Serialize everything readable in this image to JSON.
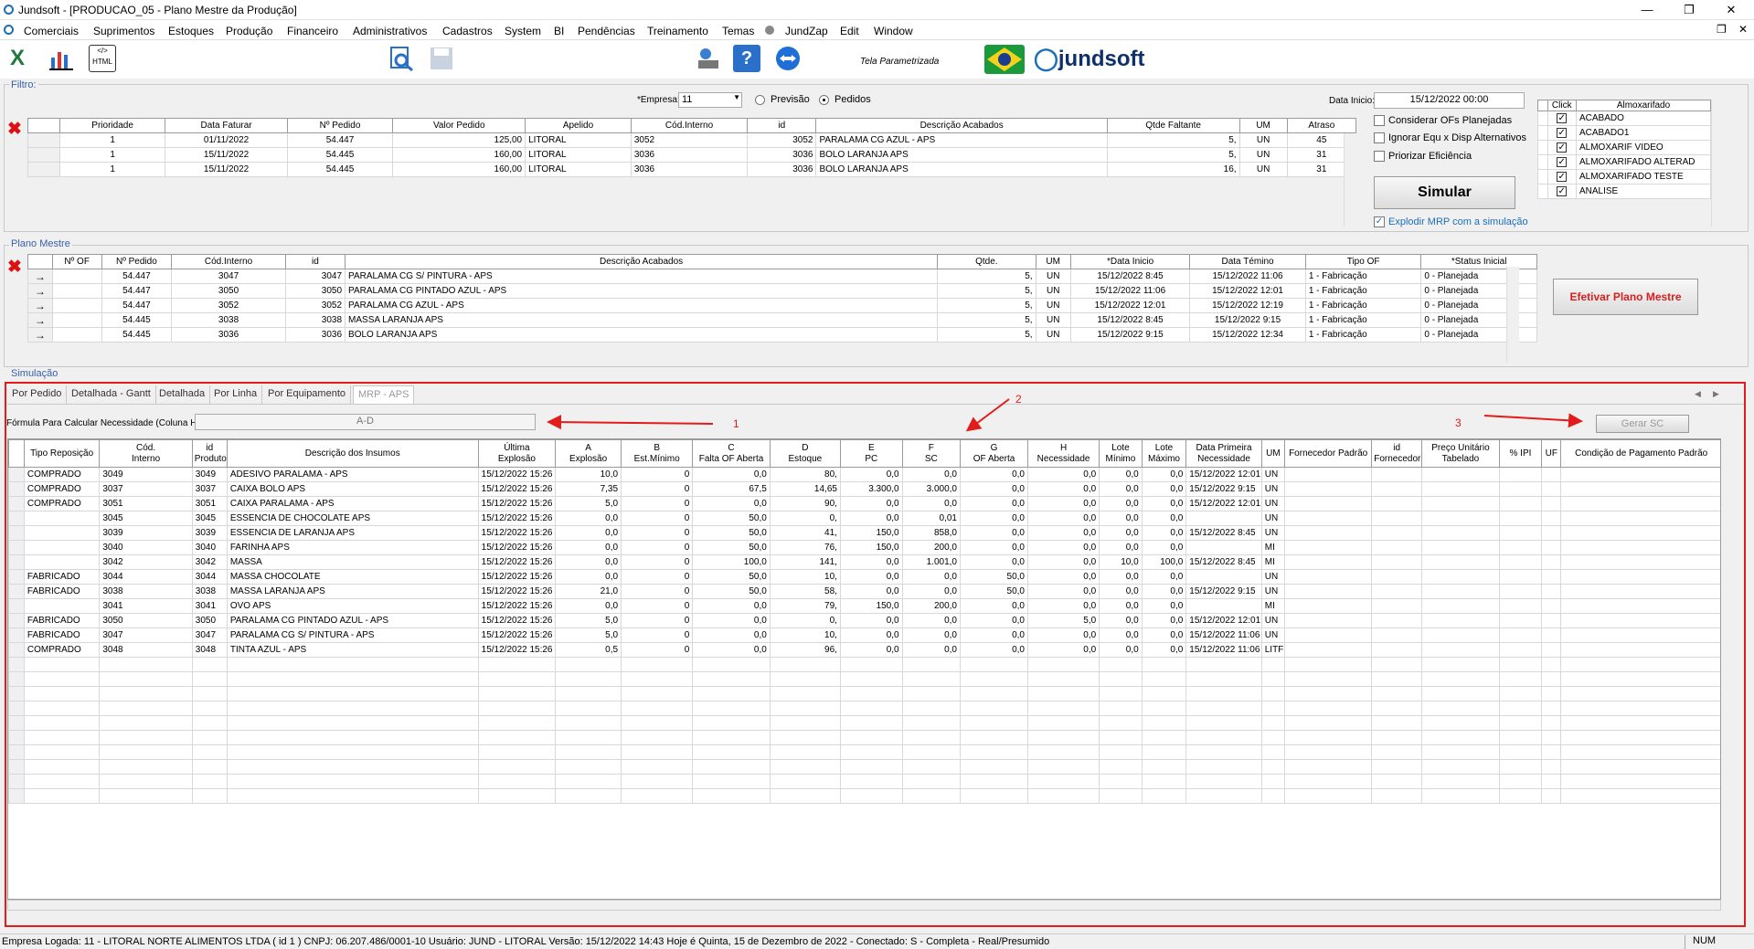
{
  "window": {
    "title": "Jundsoft - [PRODUCAO_05 - Plano Mestre da Produção]"
  },
  "menu": [
    "Comerciais",
    "Suprimentos",
    "Estoques",
    "Produção",
    "Financeiro",
    "Administrativos",
    "Cadastros",
    "System",
    "BI",
    "Pendências",
    "Treinamento",
    "Temas",
    "JundZap",
    "Edit",
    "Window"
  ],
  "toolbar": {
    "tela": "Tela Parametrizada",
    "brand": "jundsoft"
  },
  "filtro": {
    "label": "Filtro:",
    "empresa_label": "*Empresa:",
    "empresa_value": "11",
    "previsao": "Previsão",
    "pedidos": "Pedidos",
    "data_inicio_label": "Data Inicio:",
    "data_inicio": "15/12/2022 00:00",
    "opt1": "Considerar OFs Planejadas",
    "opt2": "Ignorar Equ x Disp Alternativos",
    "opt3": "Priorizar Eficiência",
    "simular": "Simular",
    "explodir": "Explodir MRP com a simulação",
    "columns": [
      "Prioridade",
      "Data Faturar",
      "Nº Pedido",
      "Valor Pedido",
      "Apelido",
      "Cód.Interno",
      "id",
      "Descrição Acabados",
      "Qtde Faltante",
      "UM",
      "Atraso"
    ],
    "rows": [
      [
        "1",
        "01/11/2022",
        "54.447",
        "125,00",
        "LITORAL",
        "3052",
        "3052",
        "PARALAMA CG AZUL - APS",
        "5,",
        "UN",
        "45"
      ],
      [
        "1",
        "15/11/2022",
        "54.445",
        "160,00",
        "LITORAL",
        "3036",
        "3036",
        "BOLO LARANJA APS",
        "5,",
        "UN",
        "31"
      ],
      [
        "1",
        "15/11/2022",
        "54.445",
        "160,00",
        "LITORAL",
        "3036",
        "3036",
        "BOLO LARANJA APS",
        "16,",
        "UN",
        "31"
      ]
    ],
    "almox_columns": [
      "Click",
      "Almoxarifado"
    ],
    "almox": [
      "ACABADO",
      "ACABADO1",
      "ALMOXARIF VIDEO",
      "ALMOXARIFADO ALTERAD",
      "ALMOXARIFADO TESTE",
      "ANALISE"
    ]
  },
  "plano": {
    "label": "Plano Mestre",
    "efetivar": "Efetivar Plano Mestre",
    "columns": [
      "Nº OF",
      "Nº Pedido",
      "Cód.Interno",
      "id",
      "Descrição Acabados",
      "Qtde.",
      "UM",
      "*Data Inicio",
      "Data Témino",
      "Tipo OF",
      "*Status Inicial"
    ],
    "rows": [
      [
        "",
        "54.447",
        "3047",
        "3047",
        "PARALAMA CG S/ PINTURA - APS",
        "5,",
        "UN",
        "15/12/2022 8:45",
        "15/12/2022 11:06",
        "1 - Fabricação",
        "0 - Planejada"
      ],
      [
        "",
        "54.447",
        "3050",
        "3050",
        "PARALAMA CG PINTADO AZUL - APS",
        "5,",
        "UN",
        "15/12/2022 11:06",
        "15/12/2022 12:01",
        "1 - Fabricação",
        "0 - Planejada"
      ],
      [
        "",
        "54.447",
        "3052",
        "3052",
        "PARALAMA CG AZUL - APS",
        "5,",
        "UN",
        "15/12/2022 12:01",
        "15/12/2022 12:19",
        "1 - Fabricação",
        "0 - Planejada"
      ],
      [
        "",
        "54.445",
        "3038",
        "3038",
        "MASSA LARANJA APS",
        "5,",
        "UN",
        "15/12/2022 8:45",
        "15/12/2022 9:15",
        "1 - Fabricação",
        "0 - Planejada"
      ],
      [
        "",
        "54.445",
        "3036",
        "3036",
        "BOLO LARANJA APS",
        "5,",
        "UN",
        "15/12/2022 9:15",
        "15/12/2022 12:34",
        "1 - Fabricação",
        "0 - Planejada"
      ]
    ]
  },
  "simulacao": {
    "label": "Simulação",
    "tabs": [
      "Por Pedido",
      "Detalhada - Gantt",
      "Detalhada",
      "Por Linha",
      "Por Equipamento",
      "MRP - APS"
    ],
    "formula_label": "Fórmula Para Calcular Necessidade (Coluna H):",
    "formula": "A-D",
    "gerar": "Gerar SC",
    "annot": [
      "1",
      "2",
      "3"
    ],
    "columns": [
      {
        "l1": "",
        "l2": "Tipo Reposição"
      },
      {
        "l1": "Cód.",
        "l2": "Interno"
      },
      {
        "l1": "id",
        "l2": "Produto"
      },
      {
        "l1": "",
        "l2": "Descrição dos Insumos"
      },
      {
        "l1": "Última",
        "l2": "Explosão"
      },
      {
        "l1": "A",
        "l2": "Explosão"
      },
      {
        "l1": "B",
        "l2": "Est.Mínimo"
      },
      {
        "l1": "C",
        "l2": "Falta OF Aberta"
      },
      {
        "l1": "D",
        "l2": "Estoque"
      },
      {
        "l1": "E",
        "l2": "PC"
      },
      {
        "l1": "F",
        "l2": "SC"
      },
      {
        "l1": "G",
        "l2": "OF Aberta"
      },
      {
        "l1": "H",
        "l2": "Necessidade"
      },
      {
        "l1": "Lote",
        "l2": "Mínimo"
      },
      {
        "l1": "Lote",
        "l2": "Máximo"
      },
      {
        "l1": "Data Primeira",
        "l2": "Necessidade"
      },
      {
        "l1": "",
        "l2": "UM"
      },
      {
        "l1": "",
        "l2": "Fornecedor Padrão"
      },
      {
        "l1": "id",
        "l2": "Fornecedor"
      },
      {
        "l1": "Preço Unitário",
        "l2": "Tabelado"
      },
      {
        "l1": "",
        "l2": "% IPI"
      },
      {
        "l1": "",
        "l2": "UF"
      },
      {
        "l1": "",
        "l2": "Condição de Pagamento Padrão"
      }
    ],
    "rows": [
      [
        "COMPRADO",
        "3049",
        "3049",
        "ADESIVO PARALAMA - APS",
        "15/12/2022 15:26",
        "10,0",
        "0",
        "0,0",
        "80,",
        "0,0",
        "0,0",
        "0,0",
        "0,0",
        "0,0",
        "0,0",
        "15/12/2022 12:01",
        "UN",
        "",
        "",
        "",
        "",
        "",
        ""
      ],
      [
        "COMPRADO",
        "3037",
        "3037",
        "CAIXA BOLO APS",
        "15/12/2022 15:26",
        "7,35",
        "0",
        "67,5",
        "14,65",
        "3.300,0",
        "3.000,0",
        "0,0",
        "0,0",
        "0,0",
        "0,0",
        "15/12/2022 9:15",
        "UN",
        "",
        "",
        "",
        "",
        "",
        ""
      ],
      [
        "COMPRADO",
        "3051",
        "3051",
        "CAIXA PARALAMA - APS",
        "15/12/2022 15:26",
        "5,0",
        "0",
        "0,0",
        "90,",
        "0,0",
        "0,0",
        "0,0",
        "0,0",
        "0,0",
        "0,0",
        "15/12/2022 12:01",
        "UN",
        "",
        "",
        "",
        "",
        "",
        ""
      ],
      [
        "",
        "3045",
        "3045",
        "ESSENCIA DE CHOCOLATE APS",
        "15/12/2022 15:26",
        "0,0",
        "0",
        "50,0",
        "0,",
        "0,0",
        "0,01",
        "0,0",
        "0,0",
        "0,0",
        "0,0",
        "",
        "UN",
        "",
        "",
        "",
        "",
        "",
        ""
      ],
      [
        "",
        "3039",
        "3039",
        "ESSENCIA DE LARANJA APS",
        "15/12/2022 15:26",
        "0,0",
        "0",
        "50,0",
        "41,",
        "150,0",
        "858,0",
        "0,0",
        "0,0",
        "0,0",
        "0,0",
        "15/12/2022 8:45",
        "UN",
        "",
        "",
        "",
        "",
        "",
        ""
      ],
      [
        "",
        "3040",
        "3040",
        "FARINHA APS",
        "15/12/2022 15:26",
        "0,0",
        "0",
        "50,0",
        "76,",
        "150,0",
        "200,0",
        "0,0",
        "0,0",
        "0,0",
        "0,0",
        "",
        "MI",
        "",
        "",
        "",
        "",
        "",
        ""
      ],
      [
        "",
        "3042",
        "3042",
        "MASSA",
        "15/12/2022 15:26",
        "0,0",
        "0",
        "100,0",
        "141,",
        "0,0",
        "1.001,0",
        "0,0",
        "0,0",
        "10,0",
        "100,0",
        "15/12/2022 8:45",
        "MI",
        "",
        "",
        "",
        "",
        "",
        ""
      ],
      [
        "FABRICADO",
        "3044",
        "3044",
        "MASSA CHOCOLATE",
        "15/12/2022 15:26",
        "0,0",
        "0",
        "50,0",
        "10,",
        "0,0",
        "0,0",
        "50,0",
        "0,0",
        "0,0",
        "0,0",
        "",
        "UN",
        "",
        "",
        "",
        "",
        "",
        ""
      ],
      [
        "FABRICADO",
        "3038",
        "3038",
        "MASSA LARANJA APS",
        "15/12/2022 15:26",
        "21,0",
        "0",
        "50,0",
        "58,",
        "0,0",
        "0,0",
        "50,0",
        "0,0",
        "0,0",
        "0,0",
        "15/12/2022 9:15",
        "UN",
        "",
        "",
        "",
        "",
        "",
        ""
      ],
      [
        "",
        "3041",
        "3041",
        "OVO APS",
        "15/12/2022 15:26",
        "0,0",
        "0",
        "0,0",
        "79,",
        "150,0",
        "200,0",
        "0,0",
        "0,0",
        "0,0",
        "0,0",
        "",
        "MI",
        "",
        "",
        "",
        "",
        "",
        ""
      ],
      [
        "FABRICADO",
        "3050",
        "3050",
        "PARALAMA CG PINTADO AZUL - APS",
        "15/12/2022 15:26",
        "5,0",
        "0",
        "0,0",
        "0,",
        "0,0",
        "0,0",
        "0,0",
        "5,0",
        "0,0",
        "0,0",
        "15/12/2022 12:01",
        "UN",
        "",
        "",
        "",
        "",
        "",
        ""
      ],
      [
        "FABRICADO",
        "3047",
        "3047",
        "PARALAMA CG S/ PINTURA - APS",
        "15/12/2022 15:26",
        "5,0",
        "0",
        "0,0",
        "10,",
        "0,0",
        "0,0",
        "0,0",
        "0,0",
        "0,0",
        "0,0",
        "15/12/2022 11:06",
        "UN",
        "",
        "",
        "",
        "",
        "",
        ""
      ],
      [
        "COMPRADO",
        "3048",
        "3048",
        "TINTA AZUL - APS",
        "15/12/2022 15:26",
        "0,5",
        "0",
        "0,0",
        "96,",
        "0,0",
        "0,0",
        "0,0",
        "0,0",
        "0,0",
        "0,0",
        "15/12/2022 11:06",
        "LITF",
        "",
        "",
        "",
        "",
        "",
        ""
      ]
    ]
  },
  "status": {
    "text": "Empresa Logada: 11 - LITORAL NORTE ALIMENTOS LTDA ( id 1 ) CNPJ: 06.207.486/0001-10    Usuário: JUND - LITORAL    Versão: 15/12/2022 14:43    Hoje é Quinta, 15 de Dezembro de 2022 - Conectado: S - Completa - Real/Presumido",
    "num": "NUM"
  },
  "colors": {
    "accent": "#1b6fb8",
    "annotation": "#e21b1b",
    "efetivar_text": "#d42020",
    "section_label": "#3a5fa8"
  }
}
